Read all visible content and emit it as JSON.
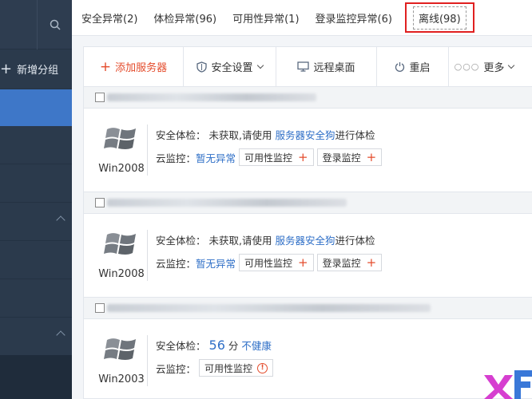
{
  "sidebar": {
    "add_group_label": "新增分组",
    "search_icon": "search-icon"
  },
  "tabs": [
    {
      "label": "安全异常(2)"
    },
    {
      "label": "体检异常(96)"
    },
    {
      "label": "可用性异常(1)"
    },
    {
      "label": "登录监控异常(6)"
    },
    {
      "label": "离线(98)"
    }
  ],
  "toolbar": {
    "add_server": "添加服务器",
    "security_settings": "安全设置",
    "remote_desktop": "远程桌面",
    "reboot": "重启",
    "more": "更多"
  },
  "servers": [
    {
      "os": "Win2008",
      "health_label": "安全体检：",
      "health_text": "未获取,请使用",
      "health_link": "服务器安全狗",
      "health_suffix": "进行体检",
      "cloud_label": "云监控：",
      "cloud_status": "暂无异常",
      "avail_label": "可用性监控",
      "login_label": "登录监控"
    },
    {
      "os": "Win2008",
      "health_label": "安全体检：",
      "health_text": "未获取,请使用",
      "health_link": "服务器安全狗",
      "health_suffix": "进行体检",
      "cloud_label": "云监控：",
      "cloud_status": "暂无异常",
      "avail_label": "可用性监控",
      "login_label": "登录监控"
    },
    {
      "os": "Win2003",
      "health_label": "安全体检：",
      "score": "56",
      "score_unit": "分",
      "health_status": "不健康",
      "cloud_label": "云监控：",
      "avail_label": "可用性监控"
    }
  ],
  "colors": {
    "accent": "#2f6fc7",
    "sidebar_bg": "#2b3a4c",
    "sidebar_active": "#3e77c8",
    "danger": "#e44c2c",
    "highlight_box": "#e02020"
  }
}
